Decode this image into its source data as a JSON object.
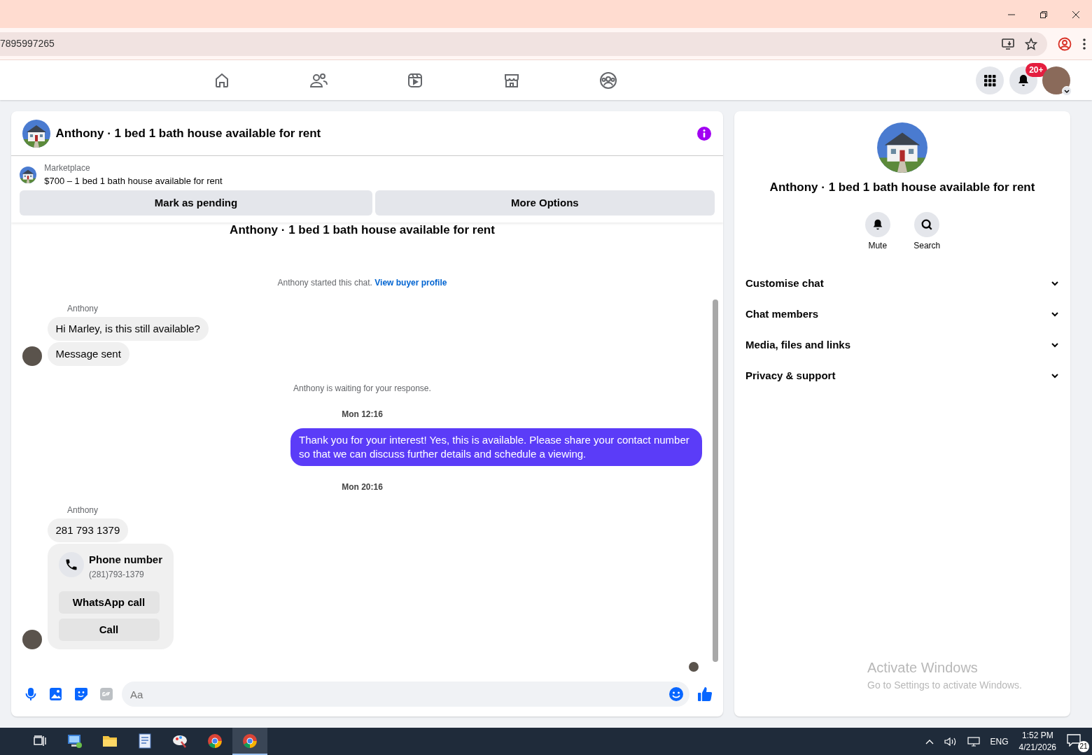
{
  "browser": {
    "url": "7895997265"
  },
  "topbar": {
    "notification_count": "20+"
  },
  "chat": {
    "title": "Anthony · 1 bed 1 bath house available for rent",
    "listing": {
      "source": "Marketplace",
      "summary": "$700 – 1 bed 1 bath house available for rent"
    },
    "actions": [
      "Mark as pending",
      "More Options"
    ],
    "intro_title": "Anthony · 1 bed 1 bath house available for rent",
    "messages": [
      {
        "kind": "system",
        "text": "Anthony started this chat.",
        "link": "View buyer profile"
      },
      {
        "kind": "sender",
        "text": "Anthony"
      },
      {
        "kind": "incoming",
        "text": "Hi Marley, is this still available?",
        "avatar": false
      },
      {
        "kind": "incoming",
        "text": "Message sent",
        "avatar": true
      },
      {
        "kind": "system",
        "text": "Anthony is waiting for your response."
      },
      {
        "kind": "time",
        "text": "Mon 12:16"
      },
      {
        "kind": "outgoing",
        "text": "Thank you for your interest! Yes, this is available. Please share your contact number so that we can discuss further details and schedule a viewing."
      },
      {
        "kind": "time",
        "text": "Mon 20:16"
      },
      {
        "kind": "sender",
        "text": "Anthony"
      },
      {
        "kind": "incoming",
        "text": "281 793 1379",
        "avatar": false
      },
      {
        "kind": "contact",
        "title": "Phone number",
        "detail": "(281)793-1379",
        "buttons": [
          "WhatsApp call",
          "Call"
        ],
        "avatar": true
      }
    ],
    "composer": {
      "placeholder": "Aa"
    }
  },
  "details": {
    "title": "Anthony · 1 bed 1 bath house available for rent",
    "actions": [
      {
        "kind": "mute",
        "label": "Mute"
      },
      {
        "kind": "search",
        "label": "Search"
      }
    ],
    "sections": [
      {
        "label": "Customise chat",
        "expanded": false
      },
      {
        "label": "Chat members",
        "expanded": false
      },
      {
        "label": "Media, files and links",
        "expanded": false
      },
      {
        "label": "Privacy & support",
        "expanded": false
      }
    ]
  },
  "watermark": {
    "title": "Activate Windows",
    "text": "Go to Settings to activate Windows."
  },
  "taskbar": {
    "apps": [
      {
        "kind": "task-view",
        "selected": false
      },
      {
        "kind": "computer",
        "selected": false
      },
      {
        "kind": "folder",
        "selected": false
      },
      {
        "kind": "document",
        "selected": false
      },
      {
        "kind": "paint",
        "selected": false
      },
      {
        "kind": "chrome",
        "selected": false
      },
      {
        "kind": "chrome",
        "selected": true
      }
    ],
    "language": "ENG",
    "time": "1:52 PM",
    "date": "4/21/2026",
    "notifications": "21"
  }
}
